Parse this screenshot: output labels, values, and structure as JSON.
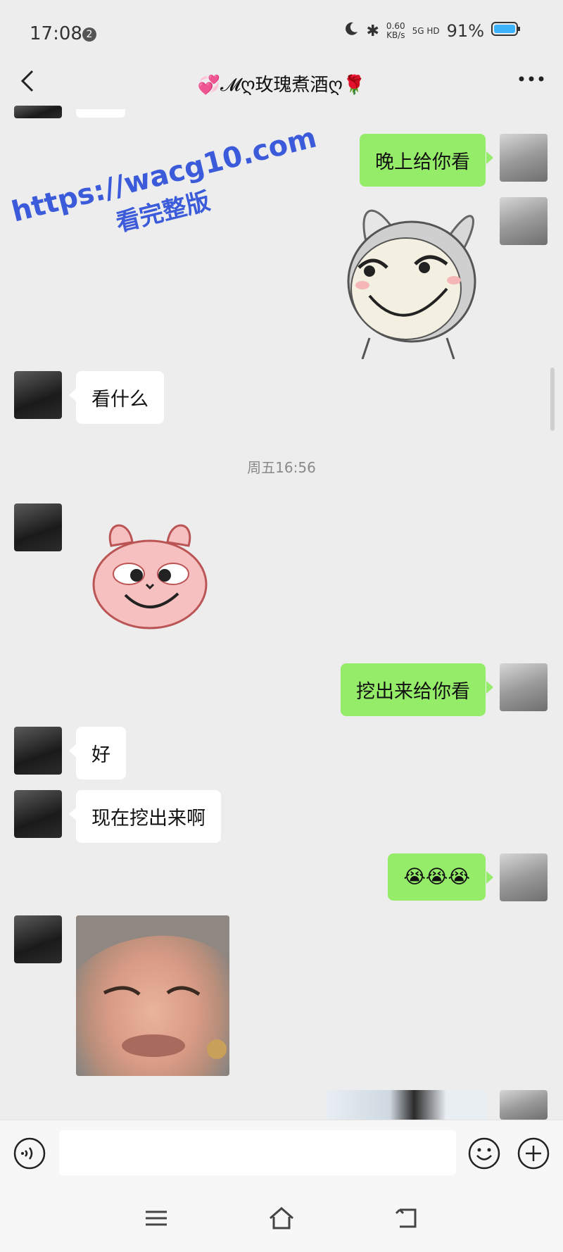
{
  "status": {
    "time": "17:08",
    "net_speed": "0.60",
    "net_unit": "KB/s",
    "signal": "5G HD",
    "battery": "91%"
  },
  "header": {
    "title": "💞𝓜ღ玫瑰煮酒ღ🌹"
  },
  "messages": {
    "m1": "晚上给你看",
    "m2": "看什么",
    "m3": "挖出来给你看",
    "m4": "好",
    "m5": "现在挖出来啊",
    "m6": "😭😭😭"
  },
  "timestamp": "周五16:56",
  "watermark": {
    "line1": "https://wacg10.com",
    "line2": "看完整版"
  },
  "icons": {
    "back": "back-arrow-icon",
    "more": "more-dots-icon",
    "voice": "voice-icon",
    "emoji": "emoji-icon",
    "plus": "plus-icon",
    "menu": "menu-icon",
    "home": "home-icon",
    "return": "return-icon"
  }
}
